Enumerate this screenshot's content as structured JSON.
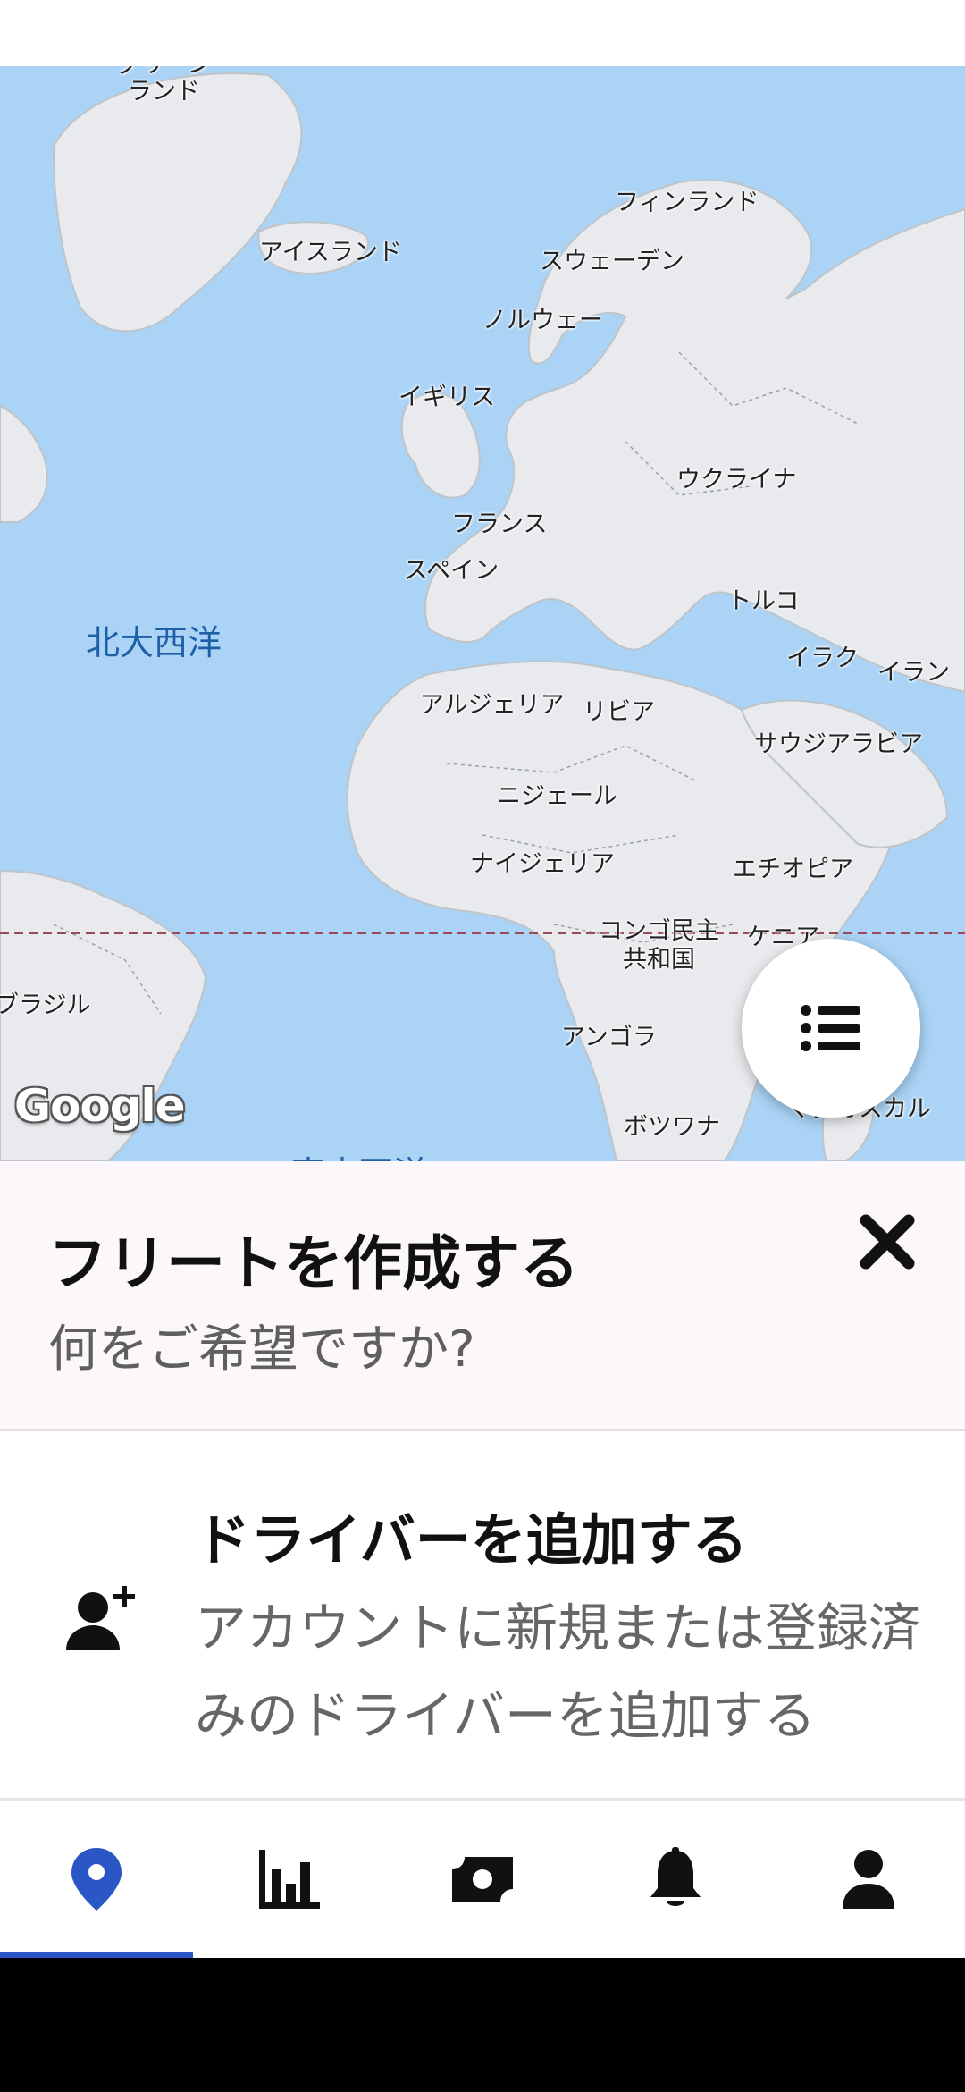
{
  "map": {
    "ocean_labels": {
      "north_atlantic": "北大西洋",
      "south_atlantic": "南大西洋"
    },
    "country_labels": {
      "greenland": "グリーン\nランド",
      "iceland": "アイスランド",
      "finland": "フィンランド",
      "sweden": "スウェーデン",
      "norway": "ノルウェー",
      "uk": "イギリス",
      "ukraine": "ウクライナ",
      "france": "フランス",
      "spain": "スペイン",
      "turkey": "トルコ",
      "iraq": "イラク",
      "iran": "イラン",
      "algeria": "アルジェリア",
      "libya": "リビア",
      "saudi": "サウジアラビア",
      "niger": "ニジェール",
      "nigeria": "ナイジェリア",
      "ethiopia": "エチオピア",
      "drc": "コンゴ民主\n共和国",
      "kenya": "ケニア",
      "brazil": "ブラジル",
      "angola": "アンゴラ",
      "botswana": "ボツワナ",
      "madagascar": "マダガスカル"
    },
    "attribution": "Google",
    "colors": {
      "water": "#aad3f5",
      "land": "#e8eaed",
      "border": "#9aa0a6",
      "equator": "#9c4a5a"
    }
  },
  "fab": {
    "icon": "list-icon"
  },
  "create_fleet": {
    "title": "フリートを作成する",
    "subtitle": "何をご希望ですか?",
    "close_icon": "close-icon"
  },
  "add_driver": {
    "icon": "add-person-icon",
    "title": "ドライバーを追加する",
    "description": "アカウントに新規または登録済みのドライバーを追加する"
  },
  "bottom_nav": {
    "active_color": "#2b57c6",
    "items": [
      {
        "icon": "map-pin-icon",
        "active": true
      },
      {
        "icon": "bar-chart-icon",
        "active": false
      },
      {
        "icon": "money-icon",
        "active": false
      },
      {
        "icon": "bell-icon",
        "active": false
      },
      {
        "icon": "person-icon",
        "active": false
      }
    ]
  }
}
